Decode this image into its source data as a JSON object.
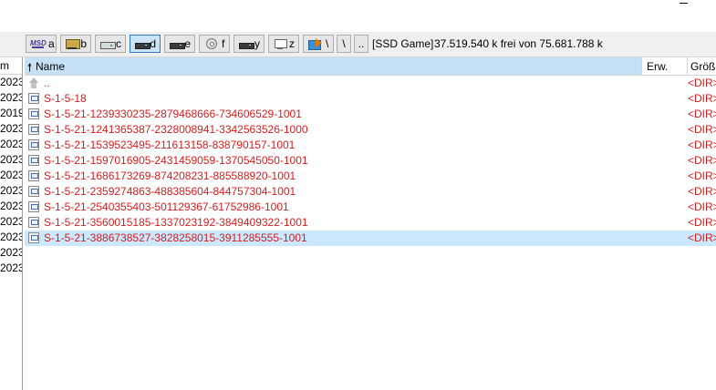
{
  "drive_buttons": [
    {
      "letter": "a",
      "icon": "msd-drive-icon"
    },
    {
      "letter": "b",
      "icon": "usb-drive-icon"
    },
    {
      "letter": "c",
      "icon": "hdd-icon"
    },
    {
      "letter": "d",
      "icon": "dark-drive-icon",
      "active": true
    },
    {
      "letter": "e",
      "icon": "dark-drive-icon"
    },
    {
      "letter": "f",
      "icon": "cd-drive-icon"
    },
    {
      "letter": "y",
      "icon": "dark-drive-icon"
    },
    {
      "letter": "z",
      "icon": "network-drive-icon"
    }
  ],
  "nav_buttons": [
    {
      "label": "\\",
      "icon": "navigate-root-icon"
    },
    {
      "label": "\\"
    },
    {
      "label": ".."
    }
  ],
  "drive_info": {
    "volume_label": "[SSD Game]",
    "free_space": "37.519.540 k frei von 75.681.788 k"
  },
  "left_panel": {
    "header": "m",
    "years": [
      "2023",
      "2023",
      "2019",
      "2023",
      "2023",
      "2023",
      "2023",
      "2023",
      "2023",
      "2023",
      "2023",
      "2023",
      "2023"
    ]
  },
  "columns": {
    "name": "Name",
    "ext": "Erw.",
    "size": "Größe"
  },
  "files": [
    {
      "name": "..",
      "size": "<DIR>",
      "icon": "up-folder-icon"
    },
    {
      "name": "S-1-5-18",
      "size": "<DIR>"
    },
    {
      "name": "S-1-5-21-1239330235-2879468666-734606529-1001",
      "size": "<DIR>"
    },
    {
      "name": "S-1-5-21-1241365387-2328008941-3342563526-1000",
      "size": "<DIR>"
    },
    {
      "name": "S-1-5-21-1539523495-211613158-838790157-1001",
      "size": "<DIR>"
    },
    {
      "name": "S-1-5-21-1597016905-2431459059-1370545050-1001",
      "size": "<DIR>"
    },
    {
      "name": "S-1-5-21-1686173269-874208231-885588920-1001",
      "size": "<DIR>"
    },
    {
      "name": "S-1-5-21-2359274863-488385604-844757304-1001",
      "size": "<DIR>"
    },
    {
      "name": "S-1-5-21-2540355403-501129367-61752986-1001",
      "size": "<DIR>"
    },
    {
      "name": "S-1-5-21-3560015185-1337023192-3849409322-1001",
      "size": "<DIR>"
    },
    {
      "name": "S-1-5-21-3886738527-3828258015-3911285555-1001",
      "size": "<DIR>",
      "selected": true
    }
  ],
  "colors": {
    "dir_text": "#d31e1e",
    "selection": "#cce8ff",
    "header_active": "#c6e0f5"
  }
}
